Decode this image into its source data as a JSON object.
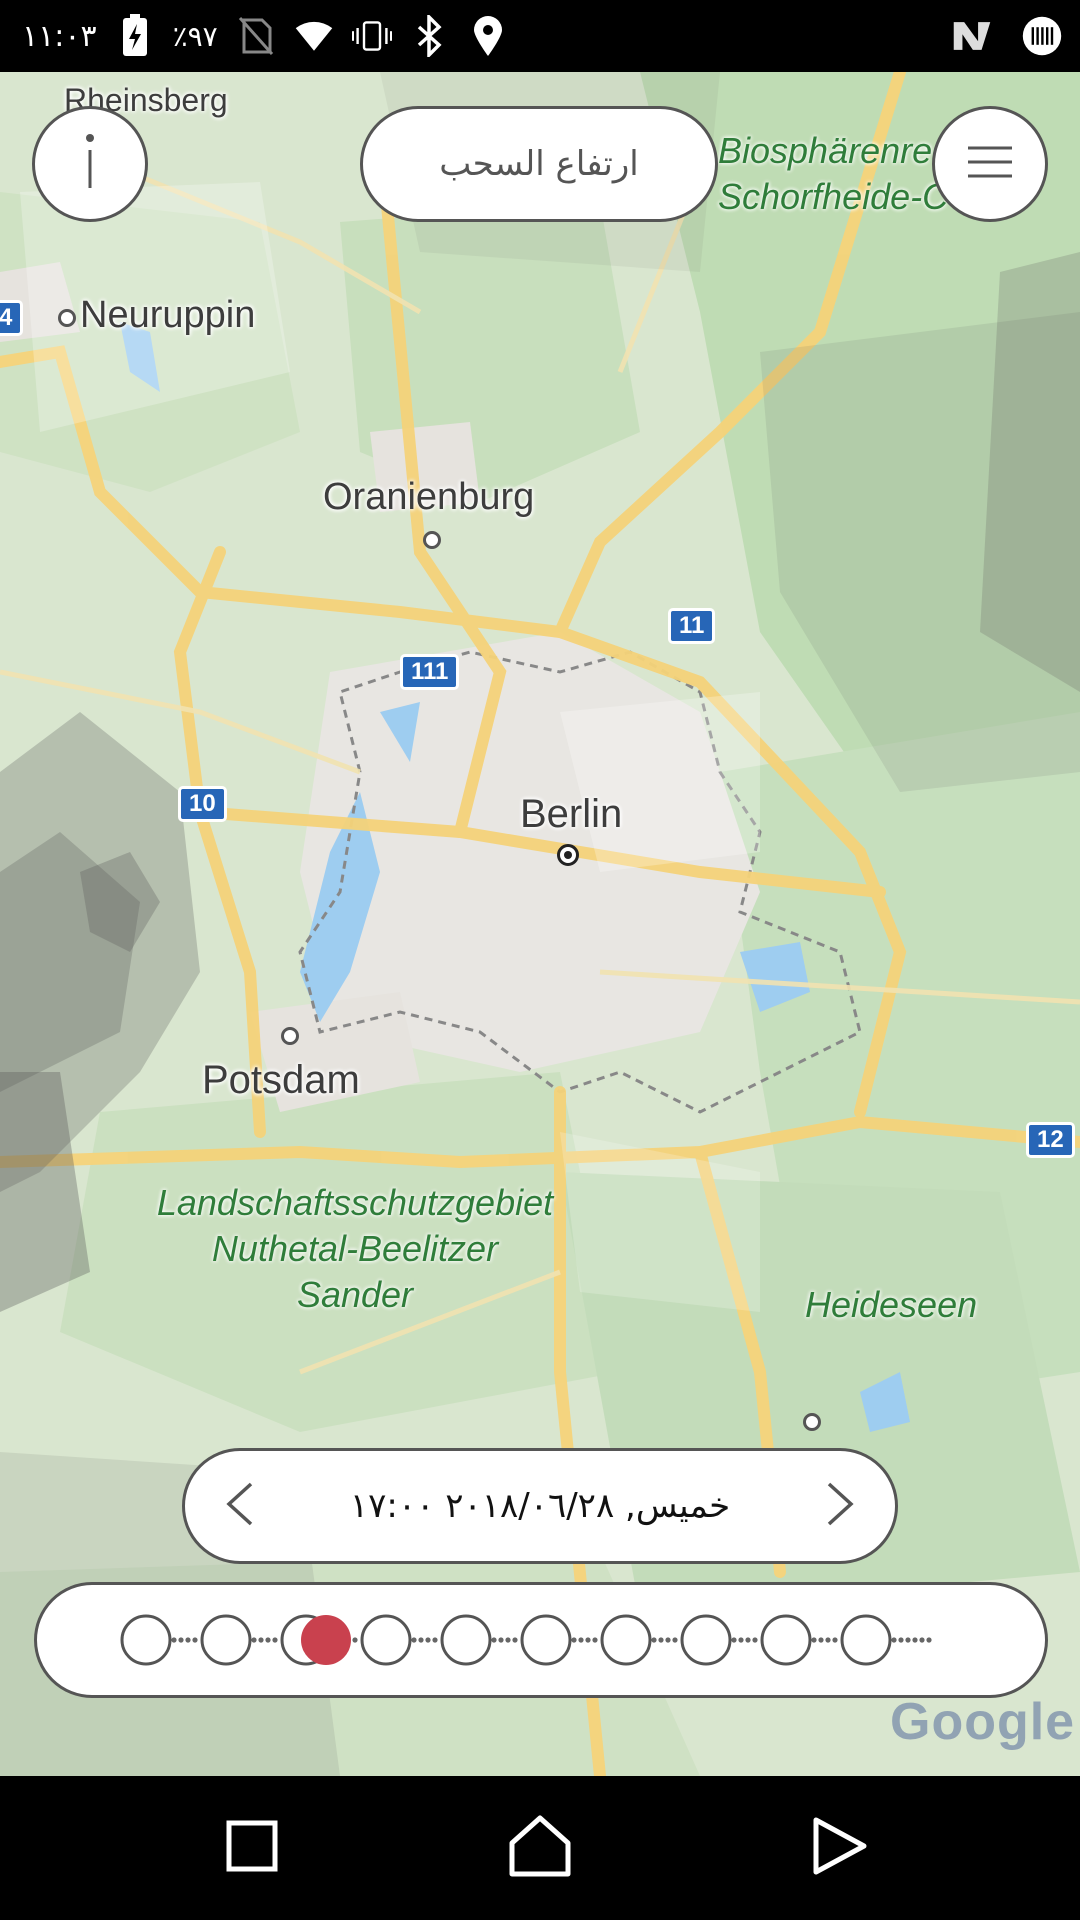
{
  "status_bar": {
    "time": "١١:٠٣",
    "battery": "٪٩٧",
    "icons": [
      "charging-battery-icon",
      "no-sim-icon",
      "wifi-icon",
      "vibrate-icon",
      "bluetooth-icon",
      "location-icon",
      "n-app-icon",
      "barcode-app-icon"
    ]
  },
  "header": {
    "info_icon": "info-icon",
    "cloud_height_label": "ارتفاع السحب",
    "menu_icon": "menu-icon"
  },
  "map": {
    "places": {
      "rheinsberg": "Rheinsberg",
      "neuruppin": "Neuruppin",
      "oranienburg": "Oranienburg",
      "berlin": "Berlin",
      "potsdam": "Potsdam"
    },
    "parks": {
      "biosphere_line1": "Biosphärenre",
      "biosphere_line2": "Schorfheide-C",
      "landschaft_line1": "Landschaftsschutzgebiet",
      "landschaft_line2": "Nuthetal-Beelitzer",
      "landschaft_line3": "Sander",
      "heideseen": "Heideseen"
    },
    "shields": {
      "a24": "4",
      "a11": "11",
      "a111": "111",
      "a10": "10",
      "a12": "12"
    },
    "attribution": "Google"
  },
  "time_control": {
    "date_label": "خميس, ٢٠١٨/٠٦/٢٨ ١٧:٠٠",
    "prev_icon": "chevron-left-icon",
    "next_icon": "chevron-right-icon"
  },
  "timeline": {
    "step_count": 10,
    "selected_index": 2,
    "selected_color": "#c9414e"
  },
  "nav_bar": {
    "icons": [
      "recents-square-icon",
      "home-icon",
      "back-triangle-icon"
    ]
  }
}
